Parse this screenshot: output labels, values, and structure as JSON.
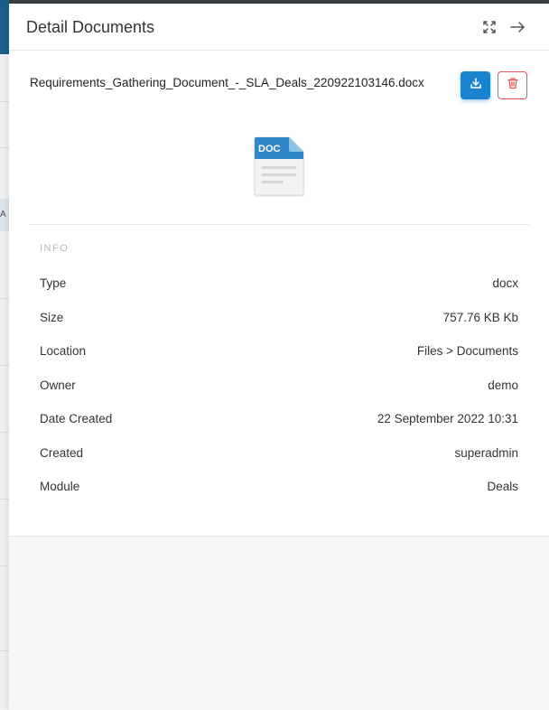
{
  "panel": {
    "title": "Detail Documents"
  },
  "file": {
    "name": "Requirements_Gathering_Document_-_SLA_Deals_220922103146.docx",
    "icon_label": "DOC"
  },
  "info": {
    "section_title": "INFO",
    "rows": [
      {
        "label": "Type",
        "value": "docx"
      },
      {
        "label": "Size",
        "value": "757.76 KB Kb"
      },
      {
        "label": "Location",
        "value": "Files > Documents"
      },
      {
        "label": "Owner",
        "value": "demo"
      },
      {
        "label": "Date Created",
        "value": "22 September 2022 10:31"
      },
      {
        "label": "Created",
        "value": "superadmin"
      },
      {
        "label": "Module",
        "value": "Deals"
      }
    ]
  },
  "background": {
    "fragment": "A"
  },
  "colors": {
    "primary": "#1a84d0",
    "danger": "#e35a5a",
    "doc_blue": "#2f87c8"
  }
}
